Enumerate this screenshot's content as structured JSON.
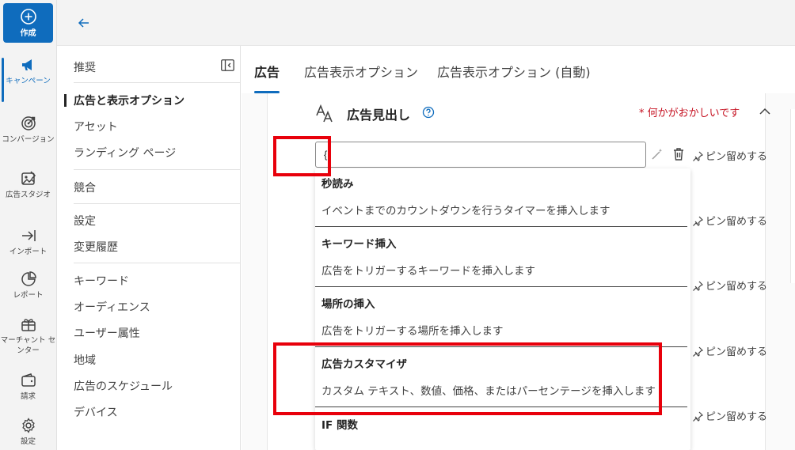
{
  "rail": {
    "create_label": "作成",
    "items": [
      {
        "label": "キャンペーン",
        "icon": "megaphone-icon"
      },
      {
        "label": "コンバージョン",
        "icon": "target-icon"
      },
      {
        "label": "広告スタジオ",
        "icon": "ad-studio-icon"
      },
      {
        "label": "インポート",
        "icon": "import-icon"
      },
      {
        "label": "レポート",
        "icon": "report-icon"
      },
      {
        "label": "マーチャント センター",
        "icon": "merchant-gift-icon"
      },
      {
        "label": "請求",
        "icon": "wallet-icon"
      },
      {
        "label": "設定",
        "icon": "gear-icon"
      }
    ]
  },
  "subnav": {
    "title": "推奨",
    "items": [
      {
        "label": "広告と表示オプション"
      },
      {
        "label": "アセット"
      },
      {
        "label": "ランディング ページ"
      },
      {
        "label": "競合"
      },
      {
        "label": "設定"
      },
      {
        "label": "変更履歴"
      },
      {
        "label": "キーワード"
      },
      {
        "label": "オーディエンス"
      },
      {
        "label": "ユーザー属性"
      },
      {
        "label": "地域"
      },
      {
        "label": "広告のスケジュール"
      },
      {
        "label": "デバイス"
      }
    ]
  },
  "tabs": [
    {
      "label": "広告"
    },
    {
      "label": "広告表示オプション"
    },
    {
      "label": "広告表示オプション (自動)"
    }
  ],
  "section": {
    "heading": "広告見出し",
    "error": "* 何かがおかしいです",
    "input_value": "{",
    "pin_label": "ピン留めする"
  },
  "dropdown": [
    {
      "title": "秒読み",
      "desc": "イベントまでのカウントダウンを行うタイマーを挿入します"
    },
    {
      "title": "キーワード挿入",
      "desc": "広告をトリガーするキーワードを挿入します"
    },
    {
      "title": "場所の挿入",
      "desc": "広告をトリガーする場所を挿入します"
    },
    {
      "title": "広告カスタマイザ",
      "desc": "カスタム テキスト、数値、価格、またはパーセンテージを挿入します"
    },
    {
      "title": "IF 関数",
      "desc": ""
    }
  ],
  "colors": {
    "accent": "#0f6cbd",
    "error": "#c50f1f",
    "highlight": "#e8000b"
  }
}
